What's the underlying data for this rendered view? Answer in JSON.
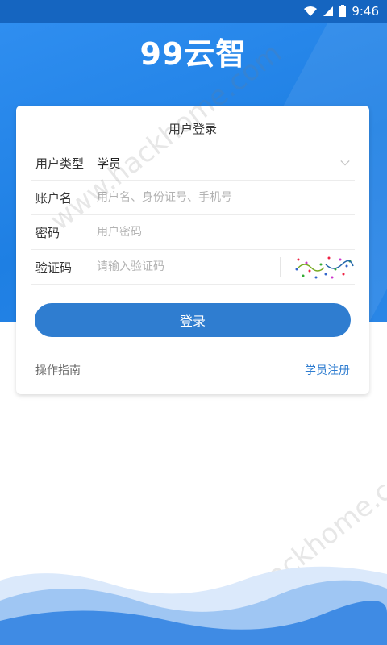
{
  "status_bar": {
    "time": "9:46",
    "icons": [
      "wifi-icon",
      "signal-icon",
      "battery-icon"
    ]
  },
  "brand": {
    "logo_text": "99云智"
  },
  "login_card": {
    "title": "用户登录",
    "user_type": {
      "label": "用户类型",
      "value": "学员"
    },
    "account": {
      "label": "账户名",
      "placeholder": "用户名、身份证号、手机号"
    },
    "password": {
      "label": "密码",
      "placeholder": "用户密码"
    },
    "captcha": {
      "label": "验证码",
      "placeholder": "请输入验证码"
    },
    "login_button": "登录",
    "guide_link": "操作指南",
    "register_link": "学员注册"
  },
  "watermark": {
    "text": "www.hackhome.com"
  },
  "colors": {
    "primary": "#2f7dd0",
    "hero": "#2a86e6",
    "status_bar": "#1565c0"
  }
}
